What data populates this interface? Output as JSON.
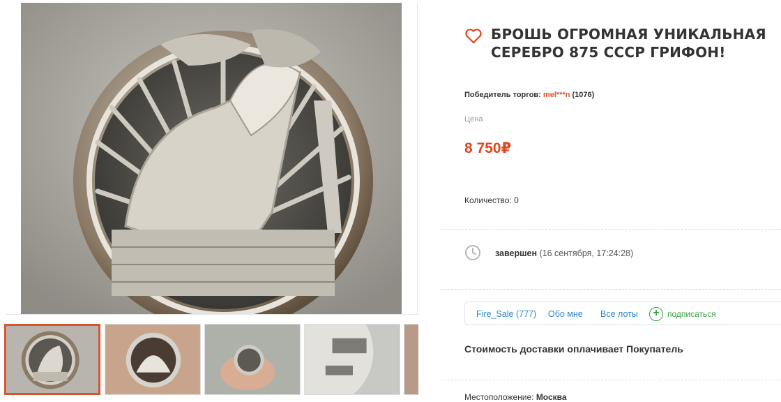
{
  "listing": {
    "title": "БРОШЬ ОГРОМНАЯ УНИКАЛЬНАЯ СЕРЕБРО 875 СССР ГРИФОН!",
    "winner_label": "Победитель торгов:",
    "winner_nick": "mel***n",
    "winner_rating": "(1076)",
    "price_label": "Цена",
    "price": "8 750₽",
    "quantity_label": "Количество:",
    "quantity_value": "0",
    "status_label": "завершен",
    "status_date": "(16 сентября, 17:24:28)",
    "shipping": "Стоимость доставки оплачивает Покупатель",
    "location_label": "Местоположение:",
    "location_value": "Москва"
  },
  "seller": {
    "name_link": "Fire_Sale (777)",
    "about_link": "Обо мне",
    "all_lots_link": "Все лоты",
    "subscribe_label": "подписаться"
  },
  "gallery": {
    "active_thumb": 0,
    "thumbs": [
      "brooch-front",
      "brooch-on-palm",
      "brooch-small-on-palm",
      "brooch-back-hallmark",
      "brooch-partial"
    ]
  },
  "colors": {
    "accent_orange": "#e2451d",
    "link_blue": "#2a87c8",
    "subscribe_green": "#3aa045"
  },
  "icons": [
    "heart-icon",
    "clock-icon",
    "plus-circle-icon"
  ]
}
